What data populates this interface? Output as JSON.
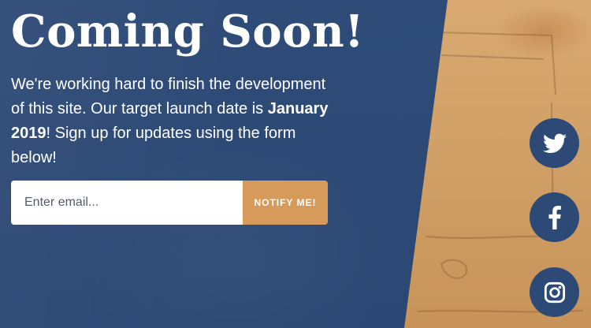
{
  "hero": {
    "title": "Coming Soon!",
    "description_part1": "We're working hard to finish the development of this site. Our target launch date is ",
    "launch_date": "January 2019",
    "description_part2": "! Sign up for updates using the form below!"
  },
  "signup": {
    "email_placeholder": "Enter email...",
    "button_label": "NOTIFY ME!"
  },
  "social": [
    {
      "name": "twitter",
      "icon": "twitter-icon"
    },
    {
      "name": "facebook",
      "icon": "facebook-icon"
    },
    {
      "name": "instagram",
      "icon": "instagram-icon"
    }
  ],
  "colors": {
    "overlay_blue": "#2e4b77",
    "accent_orange": "#d69a5a",
    "social_circle": "#2c4a75"
  }
}
